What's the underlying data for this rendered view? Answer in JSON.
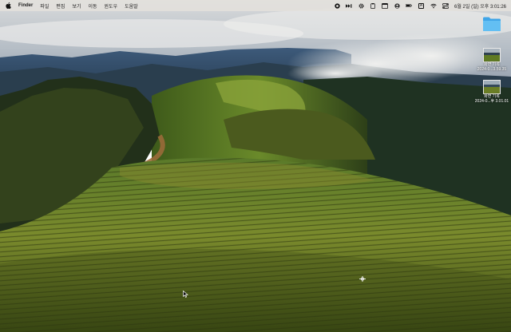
{
  "menubar": {
    "app_name": "Finder",
    "menus": [
      "파일",
      "편집",
      "보기",
      "이동",
      "윈도우",
      "도움말"
    ],
    "status_icons": [
      "record-icon",
      "media-icon",
      "settings-gear-icon",
      "clipboard-icon",
      "window-icon",
      "account-icon",
      "battery-icon",
      "keyboard-input-icon",
      "wifi-icon",
      "control-center-icon"
    ],
    "input_source": "A",
    "datetime": "6월 2일 (일) 오후 3:01:26"
  },
  "desktop": {
    "folder_name": "",
    "items": [
      {
        "line1": "화면 기록",
        "line2": "2024-0...3.59.35"
      },
      {
        "line1": "화면 기록",
        "line2": "2024-0...후 3.01.01"
      }
    ]
  },
  "colors": {
    "menubar_bg": "#e2e0dc",
    "folder_blue": "#5ab8f0",
    "sky": "#9fb0c0",
    "vineyard_green": "#4a7a1c"
  }
}
